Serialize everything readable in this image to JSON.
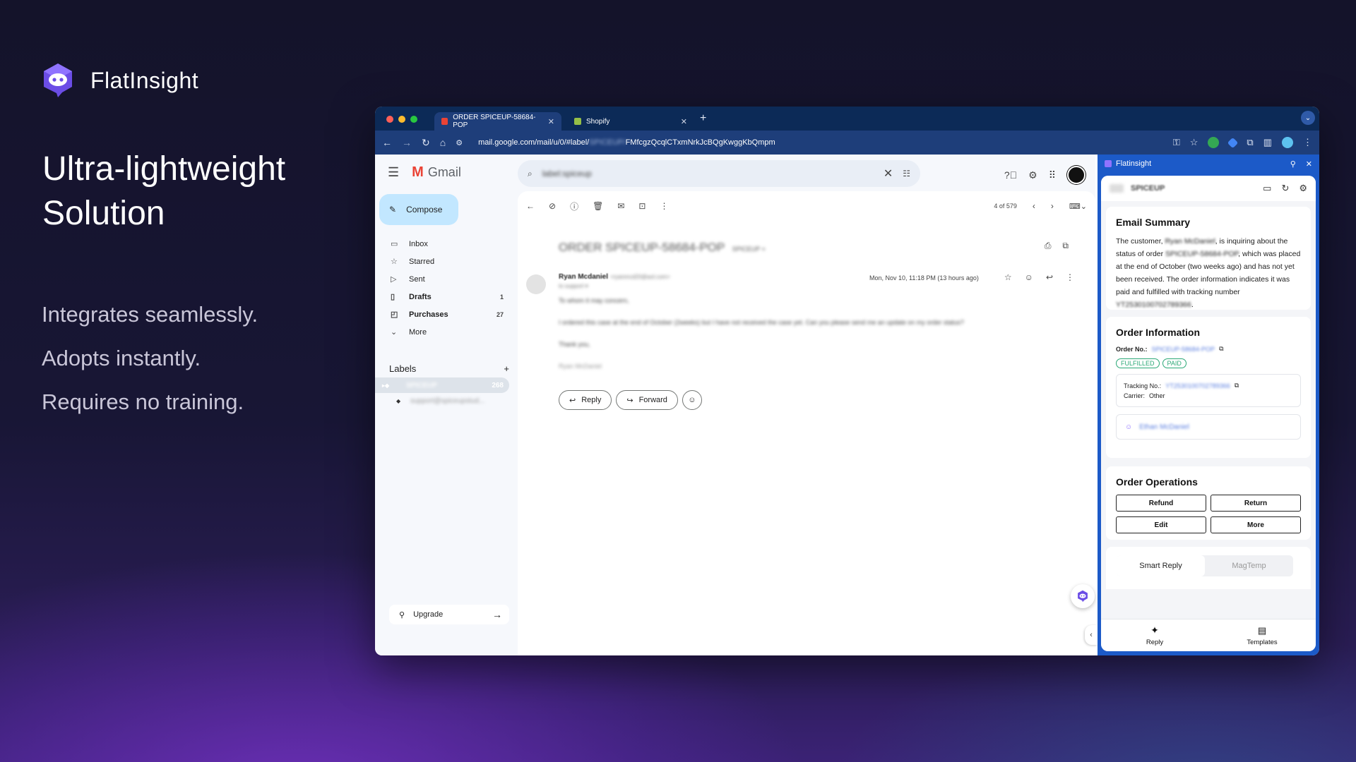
{
  "brand": {
    "name": "FlatInsight"
  },
  "headline": {
    "line1": "Ultra-lightweight",
    "line2": "Solution"
  },
  "taglines": [
    "Integrates seamlessly.",
    "Adopts instantly.",
    "Requires no training."
  ],
  "browser": {
    "tabs": [
      {
        "label": "ORDER SPICEUP-58684-POP",
        "active": true
      },
      {
        "label": "Shopify",
        "active": false
      }
    ],
    "url_prefix": "mail.google.com/mail/u/0/#label/",
    "url_blur": "SPICEUP/",
    "url_suffix": "FMfcgzQcqlCTxmNrkJcBQgKwggKbQmpm"
  },
  "gmail": {
    "app_name": "Gmail",
    "compose_label": "Compose",
    "search_value": "label:spiceup",
    "nav": [
      {
        "label": "Inbox",
        "icon": "inbox-icon",
        "count": "",
        "bold": false
      },
      {
        "label": "Starred",
        "icon": "star-icon",
        "count": "",
        "bold": false
      },
      {
        "label": "Sent",
        "icon": "send-icon",
        "count": "",
        "bold": false
      },
      {
        "label": "Drafts",
        "icon": "draft-icon",
        "count": "1",
        "bold": true
      },
      {
        "label": "Purchases",
        "icon": "bag-icon",
        "count": "27",
        "bold": true
      },
      {
        "label": "More",
        "icon": "chevron-down-icon",
        "count": "",
        "bold": false
      }
    ],
    "labels_title": "Labels",
    "label_selected": {
      "name": "SPICEUP",
      "count": "268"
    },
    "label_sub": "support@spiceupstud...",
    "upgrade_label": "Upgrade",
    "pager": "4 of 579",
    "subject": "ORDER SPICEUP-58684-POP",
    "subject_tag": "SPICEUP ×",
    "sender_name": "Ryan Mcdaniel",
    "sender_email": "<ryanmcd20@aol.com>",
    "to_line": "to support ▾",
    "date": "Mon, Nov 10, 11:18 PM (13 hours ago)",
    "body": [
      "To whom it may concern,",
      "I ordered this case at the end of October (2weeks) but I have not received the case yet. Can you please send me an update on my order status?",
      "Thank you,",
      "Ryan McDaniel"
    ],
    "reply_label": "Reply",
    "forward_label": "Forward"
  },
  "panel": {
    "title": "Flatinsight",
    "store_name": "SPICEUP",
    "summary_title": "Email Summary",
    "summary_parts": {
      "p1": "The customer, ",
      "name": "Ryan McDaniel",
      "p2": ", is inquiring about the status of order ",
      "order": "SPICEUP-58684-POP",
      "p3": ", which was placed at the end of October (two weeks ago) and has not yet been received. The order information indicates it was paid and fulfilled with tracking number ",
      "tracking": "YT2530100702789366",
      "p4": "."
    },
    "order_title": "Order Information",
    "order_no_label": "Order No.:",
    "order_no": "SPICEUP-58684-POP",
    "badges": [
      "FULFILLED",
      "PAID"
    ],
    "tracking_label": "Tracking No.:",
    "tracking_no": "YT2530100702789366",
    "carrier_label": "Carrier:",
    "carrier": "Other",
    "customer": "Ethan McDaniel",
    "ops_title": "Order Operations",
    "ops": [
      "Refund",
      "Return",
      "Edit",
      "More"
    ],
    "tabs": [
      "Smart Reply",
      "MagTemp"
    ],
    "footer": [
      "Reply",
      "Templates"
    ]
  }
}
